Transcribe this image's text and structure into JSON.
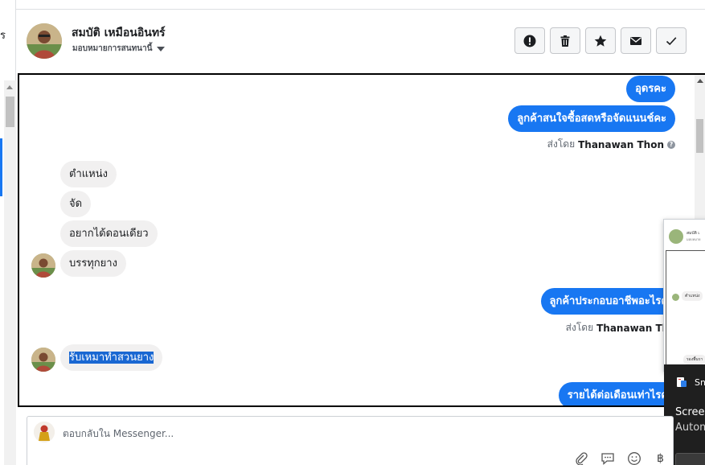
{
  "left_panel": {
    "partial_glyph": "ร"
  },
  "header": {
    "contact_name": "สมบัติ เหมือนอินทร์",
    "assign_label": "มอบหมายการสนทนานี้",
    "actions": [
      {
        "icon": "exclamation-icon"
      },
      {
        "icon": "trash-icon"
      },
      {
        "icon": "star-icon"
      },
      {
        "icon": "envelope-icon"
      },
      {
        "icon": "check-icon"
      }
    ]
  },
  "thread": {
    "messages": [
      {
        "dir": "out",
        "text": "อุดรคะ"
      },
      {
        "dir": "out",
        "text": "ลูกค้าสนใจซื้อสดหรือจัดแนนช์คะ"
      },
      {
        "dir": "meta",
        "prefix": "ส่งโดย",
        "sender": "Thanawan Thon"
      },
      {
        "dir": "in",
        "text": "ตำแหน่ง"
      },
      {
        "dir": "in",
        "text": "จัด"
      },
      {
        "dir": "in",
        "text": "อยากได้ดอนเดียว"
      },
      {
        "dir": "in",
        "text": "บรรทุกยาง"
      },
      {
        "dir": "out",
        "text": "ลูกค้าประกอบอาชีพอะไรคะ"
      },
      {
        "dir": "meta",
        "prefix": "ส่งโดย",
        "sender": "Thanawan Thon"
      },
      {
        "dir": "in",
        "text": "รับเหมาทำสวนยาง",
        "selected": true
      },
      {
        "dir": "out",
        "text": "รายได้ต่อเดือนเท่าไรคะ"
      }
    ]
  },
  "preview_popup": {
    "name": "สมบัติ เ",
    "sub": "มอบหมาย",
    "bubble_1": "ตำแหน่ง",
    "bubble_2": "รองพื้นรา"
  },
  "toast": {
    "app": "Sn",
    "title": "Screer",
    "body": "Autom"
  },
  "composer": {
    "placeholder": "ตอบกลับใน Messenger...",
    "tools": [
      "paperclip-icon",
      "speech-bubble-icon",
      "smiley-icon",
      "baht-icon"
    ],
    "baht_symbol": "฿"
  },
  "colors": {
    "accent": "#1877f2",
    "incoming_bubble": "#f1f0f0",
    "selection": "#1967d2"
  }
}
